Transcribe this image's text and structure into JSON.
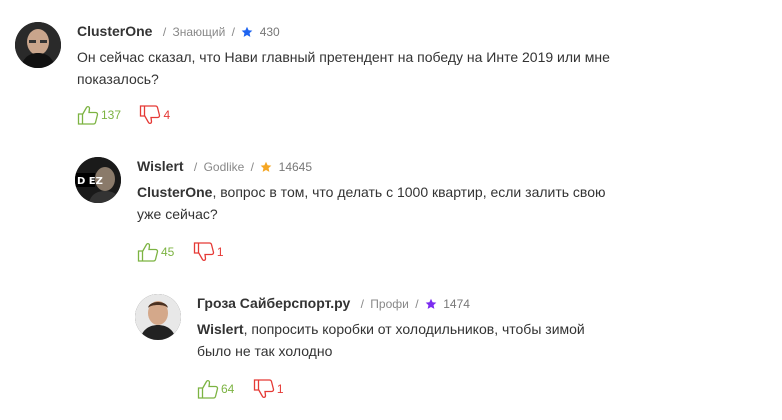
{
  "comments": [
    {
      "username": "ClusterOne",
      "rank": "Знающий",
      "star_color": "#1e64f0",
      "rating": "430",
      "mention": "",
      "text_line1": "Он сейчас сказал, что Нави главный претендент на победу на Инте 2019 или мне",
      "text_line2": "показалось?",
      "likes": "137",
      "dislikes": "4"
    },
    {
      "username": "Wislert",
      "rank": "Godlike",
      "star_color": "#f5a623",
      "rating": "14645",
      "mention": "ClusterOne",
      "text_line1": ", вопрос в том, что делать с 1000 квартир, если залить свою",
      "text_line2": "уже сейчас?",
      "likes": "45",
      "dislikes": "1"
    },
    {
      "username": "Гроза Сайберспорт.ру",
      "rank": "Профи",
      "star_color": "#7b2cf0",
      "rating": "1474",
      "mention": "Wislert",
      "text_line1": ", попросить коробки от холодильников, чтобы зимой",
      "text_line2": "было не так холодно",
      "likes": "64",
      "dislikes": "1"
    }
  ],
  "colors": {
    "like": "#7cb342",
    "dislike": "#e53935"
  },
  "icons": [
    "thumbs-up-icon",
    "thumbs-down-icon",
    "star-icon"
  ]
}
